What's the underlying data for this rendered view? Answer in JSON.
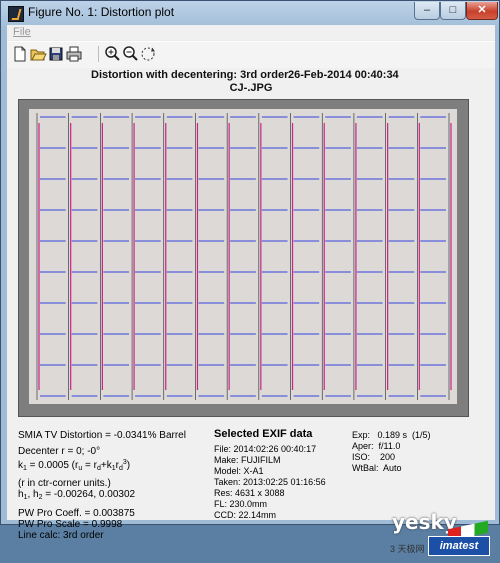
{
  "window": {
    "title": "Figure No. 1: Distortion plot",
    "controls": {
      "minimize": "–",
      "maximize": "□",
      "close": "✕"
    }
  },
  "menu": {
    "file": "File"
  },
  "toolbar": {
    "icons": [
      "new-file-icon",
      "open-folder-icon",
      "save-icon",
      "print-icon",
      "zoom-in-icon",
      "zoom-out-icon",
      "rotate-icon"
    ]
  },
  "plot": {
    "title_left": "Distortion with decentering:  3rd order",
    "title_right": "26-Feb-2014 00:40:34",
    "subtitle": "CJ-.JPG",
    "colors": {
      "horizontal": "#3344dd",
      "vertical": "#cc2288",
      "reference": "#222222"
    }
  },
  "results": {
    "smia": "SMIA TV Distortion = -0.0341% Barrel",
    "decenter_a": "Decenter r = 0;  -0°",
    "k1_a": "k",
    "k1_b": "1",
    "k1_c": " = 0.0005  (r",
    "k1_d": "u",
    "k1_e": " = r",
    "k1_f": "d",
    "k1_g": "+k",
    "k1_h": "1",
    "k1_i": "r",
    "k1_j": "d",
    "k1_k": "3",
    "k1_l": ")",
    "units": "(r in ctr-corner units.)",
    "h_a": "h",
    "h_b": "1",
    "h_c": ", h",
    "h_d": "2",
    "h_e": " = -0.00264, 0.00302",
    "pw_coeff": "PW Pro Coeff. = 0.003875",
    "pw_scale": "PW Pro Scale = 0.9998",
    "line_calc": "Line calc: 3rd order"
  },
  "exif": {
    "heading": "Selected EXIF data",
    "file": "File:  2014:02:26 00:40:17",
    "make": "Make:  FUJIFILM",
    "model": "Model: X-A1",
    "taken": "Taken: 2013:02:25 01:16:56",
    "res": "Res:    4631 x 3088",
    "fl": "FL:    230.0mm",
    "ccd": "CCD:    22.14mm",
    "exp": "Exp:   0.189 s  (1/5)",
    "aper": "Aper:  f/11.0",
    "iso": "ISO:    200",
    "wtbal": "WtBal:  Auto"
  },
  "watermark": {
    "logo": "yesky",
    "badge": "imatest",
    "small": "3 天极网"
  }
}
